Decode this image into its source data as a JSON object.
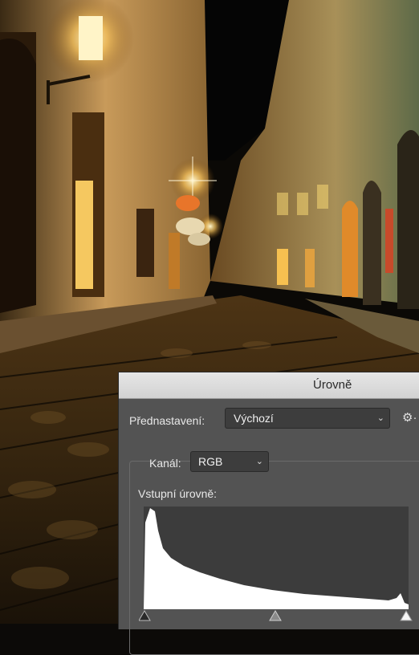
{
  "dialog": {
    "title": "Úrovně",
    "preset_label": "Přednastavení:",
    "preset_value": "Výchozí",
    "channel_label": "Kanál:",
    "channel_value": "RGB",
    "input_levels_label": "Vstupní úrovně:"
  },
  "icons": {
    "preset_chevron": "chevron-down-icon",
    "channel_chevron": "chevron-down-icon",
    "gear": "gear-icon"
  },
  "colors": {
    "dialog_bg": "#535353",
    "histogram_fill": "#ffffff",
    "titlebar": "#dcdcdc"
  }
}
